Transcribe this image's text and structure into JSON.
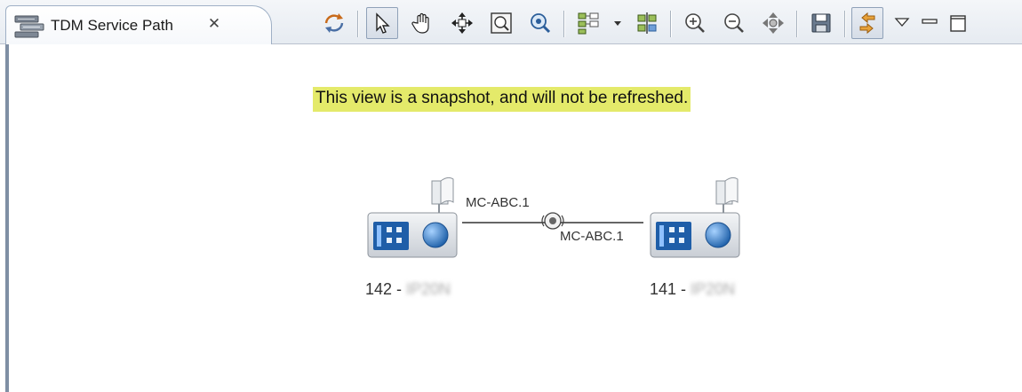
{
  "tab": {
    "title": "TDM Service Path",
    "close_glyph": "✕",
    "icon": "network-path-icon"
  },
  "toolbar": {
    "items": [
      "refresh-topology-icon",
      "select-pointer-icon",
      "pan-hand-icon",
      "move-arrows-icon",
      "zoom-to-fit-icon",
      "magnify-icon",
      "layout-icon",
      "layout-dropdown-icon",
      "align-icon",
      "zoom-in-icon",
      "zoom-out-icon",
      "pan-center-icon",
      "save-icon",
      "link-sync-icon",
      "view-menu-icon",
      "minimize-icon",
      "maximize-icon"
    ]
  },
  "banner": {
    "text": "This view is a snapshot, and will not be refreshed."
  },
  "diagram": {
    "nodes": [
      {
        "id": "142",
        "label_prefix": "142 - ",
        "label_name": "IP20N"
      },
      {
        "id": "141",
        "label_prefix": "141 - ",
        "label_name": "IP20N"
      }
    ],
    "links": [
      {
        "label_left": "MC-ABC.1",
        "label_right": "MC-ABC.1"
      }
    ]
  },
  "colors": {
    "banner_bg": "#e4ea6a",
    "tab_border": "#9fb0c6",
    "device_body": "#dfe3e8",
    "device_display": "#2e73b8"
  }
}
